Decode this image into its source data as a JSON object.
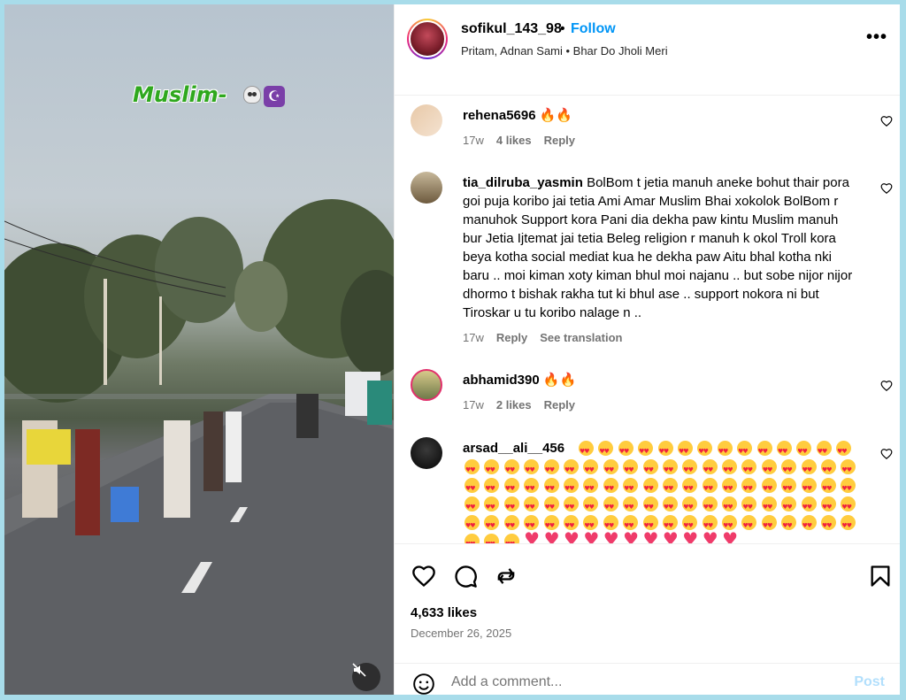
{
  "video": {
    "overlay_text": "Muslim-",
    "overlay_emoji": [
      "skull-emoji",
      "star-and-crescent-emoji"
    ],
    "mute_icon": "speaker-muted-icon"
  },
  "post": {
    "username": "sofikul_143_98",
    "separator": "•",
    "follow_label": "Follow",
    "music": "Pritam, Adnan Sami • Bhar Do Jholi Meri",
    "more_icon": "more-options-icon"
  },
  "comments": [
    {
      "user": "rehena5696",
      "text": "🔥🔥",
      "time": "17w",
      "likes": "4 likes",
      "reply": "Reply"
    },
    {
      "user": "tia_dilruba_yasmin",
      "text": "BolBom t jetia manuh aneke bohut thair pora goi puja koribo jai tetia Ami Amar Muslim Bhai xokolok BolBom r manuhok Support kora Pani dia dekha paw kintu Muslim manuh bur Jetia Ijtemat jai tetia Beleg religion r manuh k okol Troll kora beya kotha social mediat kua he dekha paw Aitu bhal kotha nki baru .. moi kiman xoty kiman bhul moi najanu .. but sobe nijor nijor dhormo t bishak rakha tut ki bhul ase .. support nokora ni but Tiroskar u tu koribo nalage n ..",
      "time": "17w",
      "reply": "Reply",
      "translate": "See translation"
    },
    {
      "user": "abhamid390",
      "text": "🔥🔥",
      "time": "17w",
      "likes": "2 likes",
      "reply": "Reply"
    },
    {
      "user": "arsad__ali__456",
      "text": "😍😍😍😍😍😍😍😍😍😍😍😍😍😍😍😍😍😍😍😍😍😍😍😍😍😍😍😍😍😍😍😍😍😍😍😍😍😍😍😍😍😍😍😍😍😍😍😍😍😍😍😍😍😍😍😍😍😍😍😍😍😍😍😍😍😍😍😍😍😍😍😍😍😍😍😍😍😍😍😍😍😍😍😍😍😍😍😍😍😍😍😍😍😍😍😍😍❤️❤️❤️❤️❤️❤️❤️❤️❤️❤️❤️"
    }
  ],
  "actions": {
    "like_icon": "heart-icon",
    "comment_icon": "comment-icon",
    "share_icon": "repost-icon",
    "save_icon": "bookmark-icon",
    "likes_count": "4,633 likes",
    "date": "December 26, 2025"
  },
  "add_comment": {
    "placeholder": "Add a comment...",
    "post_label": "Post"
  }
}
